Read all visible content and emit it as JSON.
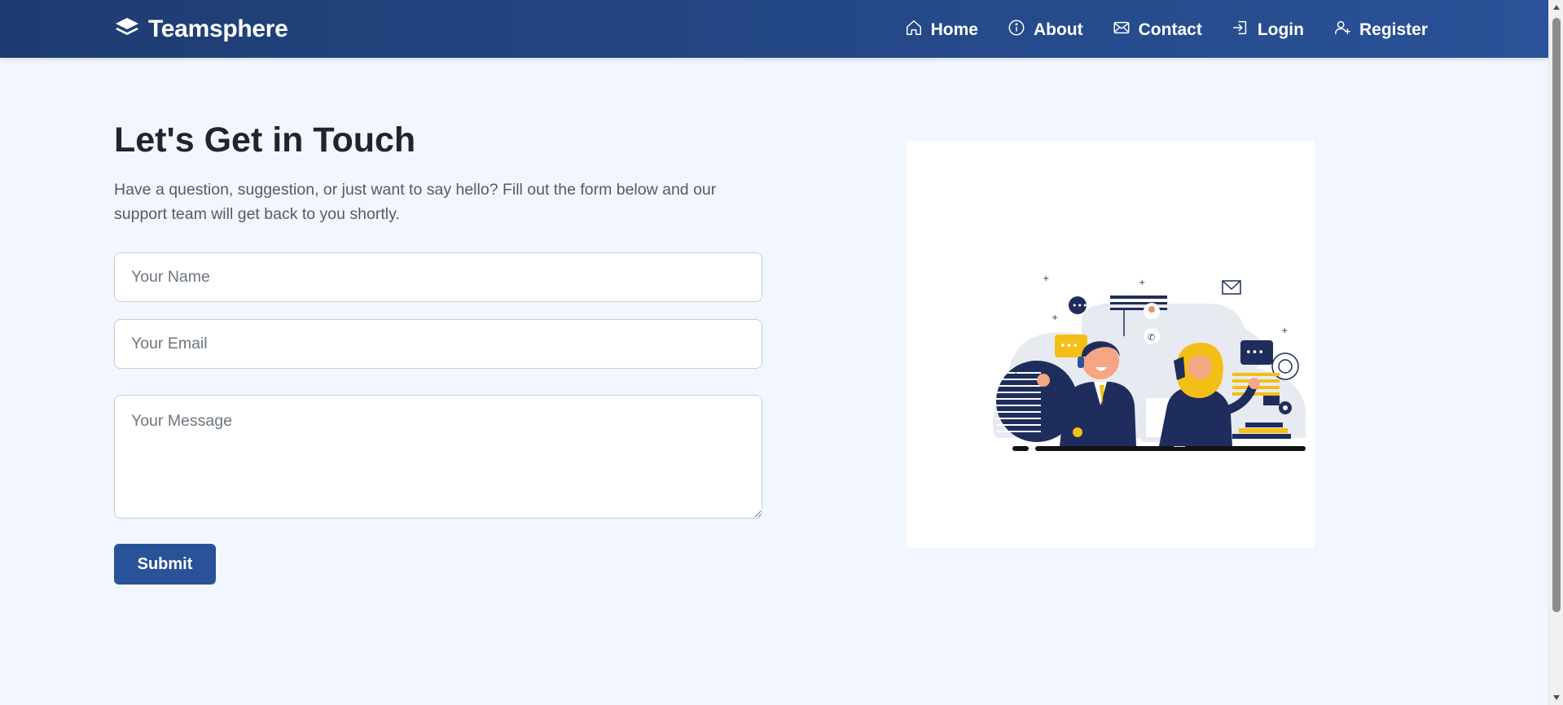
{
  "navbar": {
    "brand": "Teamsphere",
    "links": [
      {
        "label": "Home",
        "icon": "home-icon"
      },
      {
        "label": "About",
        "icon": "info-icon"
      },
      {
        "label": "Contact",
        "icon": "envelope-icon"
      },
      {
        "label": "Login",
        "icon": "login-icon"
      },
      {
        "label": "Register",
        "icon": "user-plus-icon"
      }
    ]
  },
  "contact": {
    "heading": "Let's Get in Touch",
    "description": "Have a question, suggestion, or just want to say hello? Fill out the form below and our support team will get back to you shortly.",
    "form": {
      "name_placeholder": "Your Name",
      "email_placeholder": "Your Email",
      "message_placeholder": "Your Message",
      "name_value": "",
      "email_value": "",
      "message_value": "",
      "submit_label": "Submit"
    }
  },
  "colors": {
    "nav_start": "#1e3c72",
    "nav_end": "#2a5298",
    "accent": "#2a5298",
    "page_bg": "#f2f6ff",
    "illustration_yellow": "#f3bf16",
    "illustration_navy": "#1f2d5c"
  }
}
